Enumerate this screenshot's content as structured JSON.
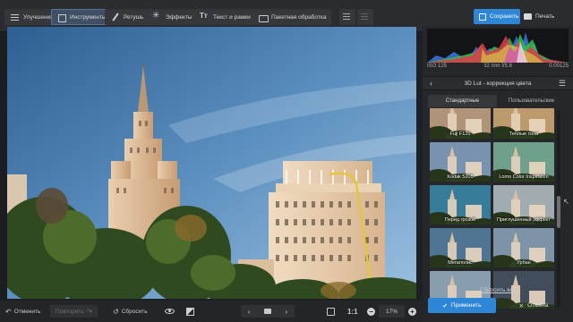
{
  "toolbar": {
    "tabs": [
      {
        "label": "Улучшения",
        "icon": "sliders-icon"
      },
      {
        "label": "Инструменты",
        "icon": "crop-icon",
        "active": true
      },
      {
        "label": "Ретушь",
        "icon": "brush-icon"
      },
      {
        "label": "Эффекты",
        "icon": "magic-wand-icon"
      },
      {
        "label": "Текст и рамки",
        "icon": "text-icon"
      },
      {
        "label": "Пакетная обработка",
        "icon": "batch-icon"
      }
    ],
    "save_label": "Сохранить",
    "print_label": "Печать"
  },
  "bottombar": {
    "undo_label": "Отменить",
    "redo_label": "Повторить",
    "reset_label": "Сбросить",
    "ratio_label": "1:1",
    "zoom_value": "17%"
  },
  "histogram_info": {
    "iso": "ISO 125",
    "lens": "32 mm f/5.6",
    "shutter": "0.00125"
  },
  "panel": {
    "title": "3D Lut - коррекция цвета",
    "tabs": [
      "Стандартные",
      "Пользовательские"
    ],
    "presets": [
      {
        "label": "Fuji F125",
        "tint": "#c9a98a"
      },
      {
        "label": "Теплые тона",
        "tint": "#d6b07a"
      },
      {
        "label": "Kodak 5205",
        "tint": "#8aa7c8"
      },
      {
        "label": "Lomo Color Inspiration",
        "tint": "#7fb7a0"
      },
      {
        "label": "Перед грозой",
        "tint": "#3f8fb0"
      },
      {
        "label": "Приглушенный эффект",
        "tint": "#b7c4c8"
      },
      {
        "label": "Мегаполис",
        "tint": "#5c86a8"
      },
      {
        "label": "Урбан",
        "tint": "#8fa9c0"
      },
      {
        "label": "",
        "tint": "#9ab3c9"
      },
      {
        "label": "",
        "tint": "#4a5868"
      }
    ],
    "reset_all_label": "Сбросить все",
    "apply_label": "Применить",
    "cancel_label": "Отмена"
  },
  "colors": {
    "accent": "#2d86d6",
    "toolbar_bg": "#2a2c30",
    "panel_bg": "#25272b"
  }
}
